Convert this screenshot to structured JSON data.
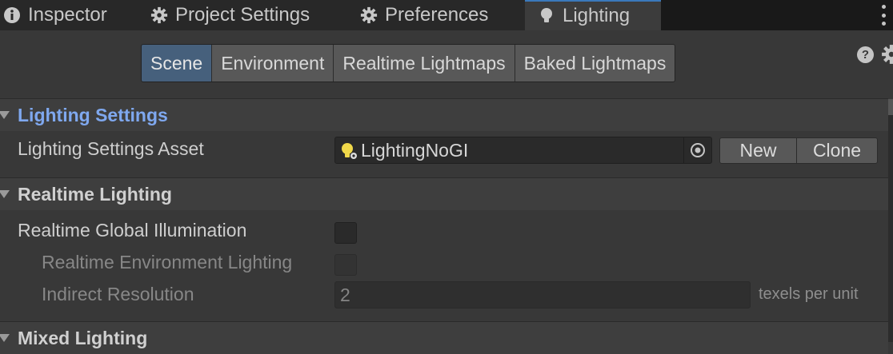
{
  "tabs": [
    {
      "label": "Inspector",
      "icon": "info-icon"
    },
    {
      "label": "Project Settings",
      "icon": "gear-icon"
    },
    {
      "label": "Preferences",
      "icon": "gear-icon"
    },
    {
      "label": "Lighting",
      "icon": "bulb-icon",
      "active": true
    }
  ],
  "toolbar": {
    "segments": [
      "Scene",
      "Environment",
      "Realtime Lightmaps",
      "Baked Lightmaps"
    ],
    "selected": "Scene",
    "help_glyph": "?"
  },
  "lighting_settings": {
    "title": "Lighting Settings",
    "asset_label": "Lighting Settings Asset",
    "asset_value": "LightingNoGI",
    "new_label": "New",
    "clone_label": "Clone"
  },
  "realtime_lighting": {
    "title": "Realtime Lighting",
    "rgi_label": "Realtime Global Illumination",
    "rgi_checked": false,
    "env_label": "Realtime Environment Lighting",
    "env_checked": false,
    "indirect_label": "Indirect Resolution",
    "indirect_value": "2",
    "indirect_unit": "texels per unit"
  },
  "mixed_lighting": {
    "title": "Mixed Lighting"
  },
  "colors": {
    "accent": "#3a79bb",
    "selected_segment": "#46607c",
    "section_title_blue": "#7fa8ef"
  }
}
